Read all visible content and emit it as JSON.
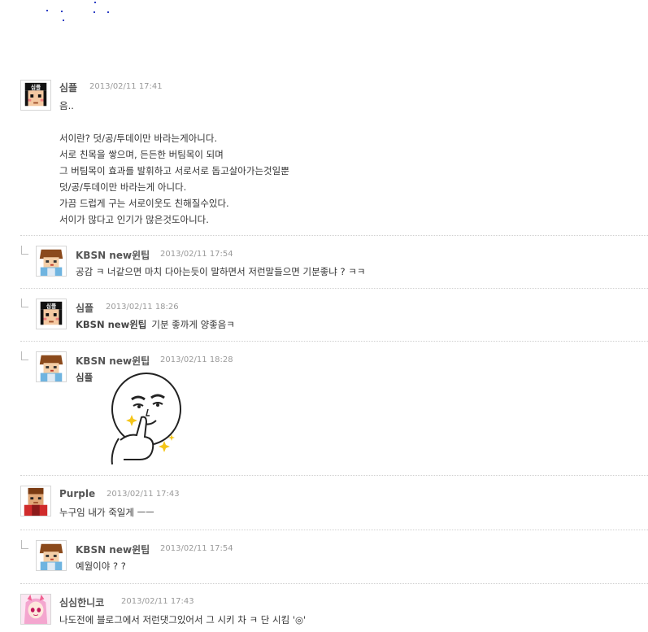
{
  "comments": [
    {
      "author": "심플",
      "date": "2013/02/11 17:41",
      "avatar": "simple-avatar",
      "lines": [
        "음..",
        "",
        "서이란? 덧/공/투데이만 바라는게아니다.",
        "서로 친목을 쌓으며, 든든한 버팀목이 되며",
        "그 버팀목이 효과를 발휘하고 서로서로 돕고살아가는것일뿐",
        "덧/공/투데이만 바라는게 아니다.",
        "가끔 드럽게 구는 서로이웃도 친해질수있다.",
        "서이가 많다고 인기가 많은것도아니다."
      ]
    },
    {
      "author": "KBSN new윈팁",
      "date": "2013/02/11 17:54",
      "avatar": "kbsn-avatar",
      "text": "공감 ㅋ 너같으면 마치 다아는듯이 말하면서 저런말들으면 기분좋냐 ? ㅋㅋ"
    },
    {
      "author": "심플",
      "date": "2013/02/11 18:26",
      "avatar": "simple-avatar",
      "mention": "KBSN new윈팁",
      "text": "기분 좋까게 양좋음ㅋ"
    },
    {
      "author": "KBSN new윈팁",
      "date": "2013/02/11 18:28",
      "avatar": "kbsn-avatar",
      "mention": "심플",
      "sticker": "smug-face-thumbs-up-sticker"
    },
    {
      "author": "Purple",
      "date": "2013/02/11 17:43",
      "avatar": "purple-avatar",
      "text": "누구임 내가 죽일게 ㅡㅡ"
    },
    {
      "author": "KBSN new윈팁",
      "date": "2013/02/11 17:54",
      "avatar": "kbsn-avatar",
      "text": "예월이야 ? ?"
    },
    {
      "author": "심심한니코",
      "date": "2013/02/11 17:43",
      "avatar": "niko-avatar",
      "text": "나도전에 블로그에서 저런댓그있어서 그 시키 차 ㅋ 단 시킴 '◎'"
    }
  ],
  "colors": {
    "author": "#555555",
    "date": "#9a9a9a",
    "text": "#333333",
    "divider": "#d0d0d0",
    "dots": "#2d3fc4"
  }
}
